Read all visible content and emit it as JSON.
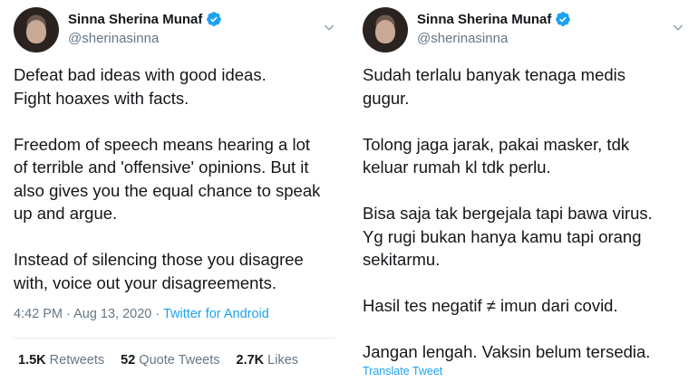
{
  "tweets": [
    {
      "author_name": "Sinna Sherina Munaf",
      "handle": "@sherinasinna",
      "body": "Defeat bad ideas with good ideas.\nFight hoaxes with facts.\n\nFreedom of speech means hearing a lot\nof terrible and 'offensive' opinions. But it\nalso gives you the equal chance to speak\nup and argue.\n\nInstead of silencing those you disagree\nwith, voice out your disagreements.",
      "timestamp": "4:42 PM · Aug 13, 2020 · ",
      "source": "Twitter for Android",
      "stats": {
        "retweets_count": "1.5K",
        "retweets_label": "Retweets",
        "quotes_count": "52",
        "quotes_label": "Quote Tweets",
        "likes_count": "2.7K",
        "likes_label": "Likes"
      }
    },
    {
      "author_name": "Sinna Sherina Munaf",
      "handle": "@sherinasinna",
      "body": "Sudah terlalu banyak tenaga medis\ngugur.\n\nTolong jaga jarak, pakai masker, tdk\nkeluar rumah kl tdk perlu.\n\nBisa saja tak bergejala tapi bawa virus.\nYg rugi bukan hanya kamu tapi orang\nsekitarmu.\n\nHasil tes negatif ≠ imun dari covid.\n\nJangan lengah. Vaksin belum tersedia.",
      "translate_label": "Translate Tweet"
    }
  ],
  "colors": {
    "accent": "#1da1f2",
    "text": "#14171a",
    "muted": "#657786"
  },
  "icons": {
    "verified": "verified-badge-icon",
    "menu": "chevron-down-icon"
  }
}
